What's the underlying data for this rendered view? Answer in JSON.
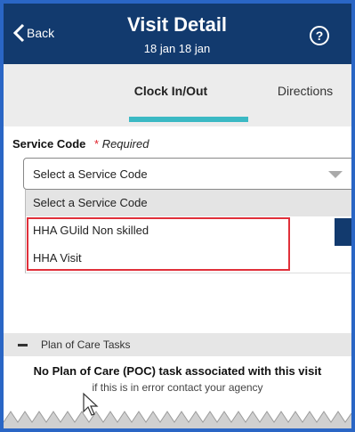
{
  "header": {
    "back_label": "Back",
    "title": "Visit Detail",
    "subtitle": "18 jan 18 jan",
    "help_glyph": "?"
  },
  "tabs": [
    {
      "label": "Clock In/Out",
      "active": true
    },
    {
      "label": "Directions",
      "active": false
    }
  ],
  "service_code": {
    "label": "Service Code",
    "required_star": "*",
    "required_text": "Required",
    "selected_value": "Select a Service Code",
    "options": [
      "Select a Service Code",
      "HHA GUild Non skilled",
      "HHA Visit"
    ]
  },
  "plan_of_care": {
    "title": "Plan of Care Tasks",
    "message": "No Plan of Care (POC) task associated with this visit",
    "sub_message": "if this is in error contact your agency"
  },
  "colors": {
    "header_bg": "#123a6e",
    "tab_indicator": "#3bb9c4",
    "highlight": "#e0303a",
    "frame": "#2a66c5"
  },
  "icons": {
    "back": "chevron-left-icon",
    "help": "question-circle-icon",
    "caret": "caret-down-icon",
    "collapse": "minus-icon",
    "cursor": "mouse-cursor-icon"
  }
}
